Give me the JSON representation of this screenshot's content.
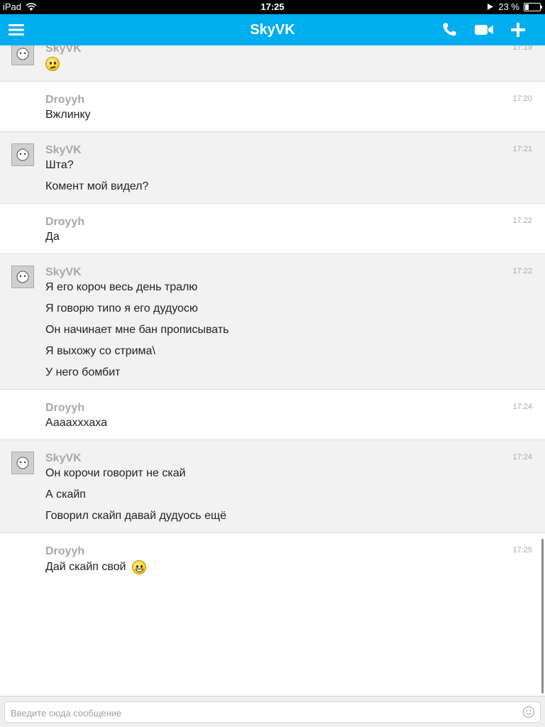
{
  "status_bar": {
    "device": "iPad",
    "time": "17:25",
    "battery": "23 %"
  },
  "navbar": {
    "title": "SkyVK",
    "icons": [
      "menu-icon",
      "phone-icon",
      "video-icon",
      "add-icon"
    ],
    "accent_color": "#00aeef"
  },
  "messages": [
    {
      "sender": "SkyVK",
      "time": "17:19",
      "lines": [],
      "emoji": "confused-emoji"
    },
    {
      "sender": "Droyyh",
      "time": "17:20",
      "lines": [
        "Вжлинку"
      ]
    },
    {
      "sender": "SkyVK",
      "time": "17:21",
      "lines": [
        "Шта?",
        "Комент мой видел?"
      ]
    },
    {
      "sender": "Droyyh",
      "time": "17:22",
      "lines": [
        "Да"
      ]
    },
    {
      "sender": "SkyVK",
      "time": "17:22",
      "lines": [
        "Я его короч весь день тралю",
        "Я говорю типо я его дудуосю",
        "Он начинает мне бан прописывать",
        "Я выхожу со стрима\\",
        "У него бомбит"
      ]
    },
    {
      "sender": "Droyyh",
      "time": "17:24",
      "lines": [
        "Аааахххаха"
      ]
    },
    {
      "sender": "SkyVK",
      "time": "17:24",
      "lines": [
        "Он корочи говорит не скай",
        "А скайп",
        "Говорил скайп давай дудуось ещё"
      ]
    },
    {
      "sender": "Droyyh",
      "time": "17:25",
      "lines": [
        "Дай скайп свой"
      ],
      "emoji": "grin-emoji"
    }
  ],
  "input": {
    "placeholder": "Введите сюда сообщение"
  }
}
